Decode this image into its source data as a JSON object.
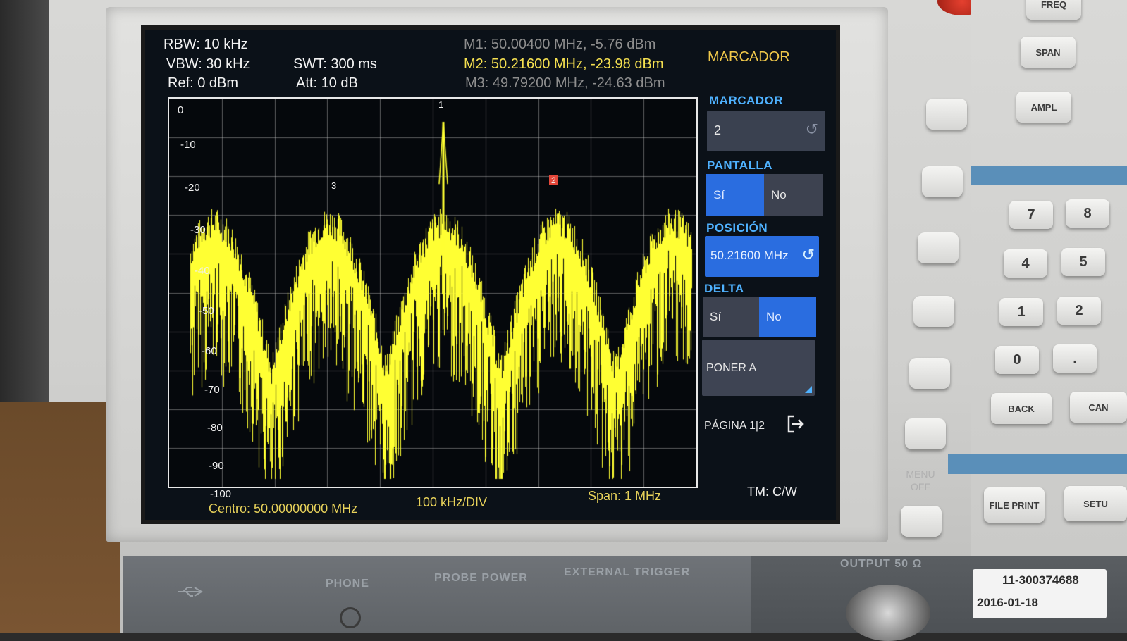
{
  "header": {
    "rbw": "RBW: 10 kHz",
    "vbw": "VBW: 30 kHz",
    "ref": "Ref: 0 dBm",
    "swt": "SWT: 300 ms",
    "att": "Att: 10 dB",
    "m1": "M1: 50.00400 MHz, -5.76 dBm",
    "m2": "M2: 50.21600 MHz, -23.98 dBm",
    "m3": "M3: 49.79200 MHz, -24.63 dBm"
  },
  "plot": {
    "y_labels": [
      "0",
      "-10",
      "-20",
      "-30",
      "-40",
      "-50",
      "-60",
      "-70",
      "-80",
      "-90",
      "-100"
    ],
    "markers": [
      "1",
      "2",
      "3"
    ],
    "trace_color": "#ffff33"
  },
  "footer": {
    "center": "Centro: 50.00000000 MHz",
    "div": "100 kHz/DIV",
    "span": "Span: 1 MHz",
    "tm": "TM: C/W"
  },
  "menu": {
    "title": "MARCADOR",
    "marcador_label": "MARCADOR",
    "marcador_value": "2",
    "pantalla_label": "PANTALLA",
    "pantalla_si": "Sí",
    "pantalla_no": "No",
    "posicion_label": "POSICIÓN",
    "posicion_value": "50.21600 MHz",
    "delta_label": "DELTA",
    "delta_si": "Sí",
    "delta_no": "No",
    "poner_a": "PONER A",
    "pagina": "PÁGINA 1|2"
  },
  "keys": {
    "freq": "FREQ",
    "span": "SPAN",
    "ampl": "AMPL",
    "n7": "7",
    "n8": "8",
    "n4": "4",
    "n5": "5",
    "n1": "1",
    "n2": "2",
    "n0": "0",
    "dot": ".",
    "back": "BACK",
    "can": "CAN",
    "file_print": "FILE PRINT",
    "setu": "SETU",
    "menu_off": "MENU OFF"
  },
  "panel": {
    "phone": "PHONE",
    "probe_power": "PROBE POWER",
    "external_trigger": "EXTERNAL TRIGGER",
    "output": "OUTPUT 50 Ω",
    "sticker_id": "11-300374688",
    "sticker_date": "2016-01-18"
  }
}
